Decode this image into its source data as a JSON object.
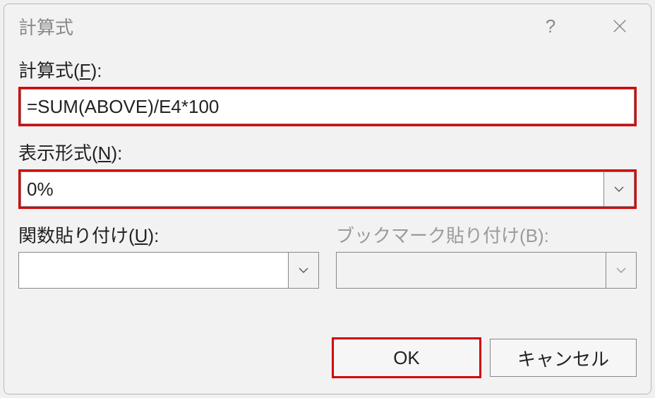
{
  "dialog": {
    "title": "計算式",
    "help_label": "?",
    "formula": {
      "label_prefix": "計算式(",
      "accesskey": "F",
      "label_suffix": "):",
      "value": "=SUM(ABOVE)/E4*100"
    },
    "format": {
      "label_prefix": "表示形式(",
      "accesskey": "N",
      "label_suffix": "):",
      "value": "0%"
    },
    "function_paste": {
      "label_prefix": "関数貼り付け(",
      "accesskey": "U",
      "label_suffix": "):",
      "value": ""
    },
    "bookmark_paste": {
      "label": "ブックマーク貼り付け(B):",
      "value": ""
    },
    "buttons": {
      "ok": "OK",
      "cancel": "キャンセル"
    }
  }
}
